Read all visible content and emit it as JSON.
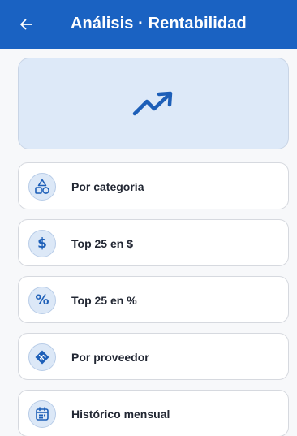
{
  "app_bar": {
    "title": "Análisis · Rentabilidad",
    "back_icon": "arrow-left-icon",
    "background": "#1a62c2"
  },
  "hero": {
    "icon": "trending-up-icon",
    "background": "#dde9f8"
  },
  "menu_items": [
    {
      "label": "Por categoría",
      "icon": "category-shapes-icon"
    },
    {
      "label": "Top 25 en $",
      "icon": "dollar-icon",
      "glyph": "$"
    },
    {
      "label": "Top 25 en %",
      "icon": "percent-icon",
      "glyph": "%"
    },
    {
      "label": "Por proveedor",
      "icon": "handshake-icon"
    },
    {
      "label": "Histórico mensual",
      "icon": "calendar-icon"
    }
  ],
  "colors": {
    "accent": "#1d5fb8",
    "card_border": "#d6d9df",
    "icon_bg": "#dce8f7"
  }
}
